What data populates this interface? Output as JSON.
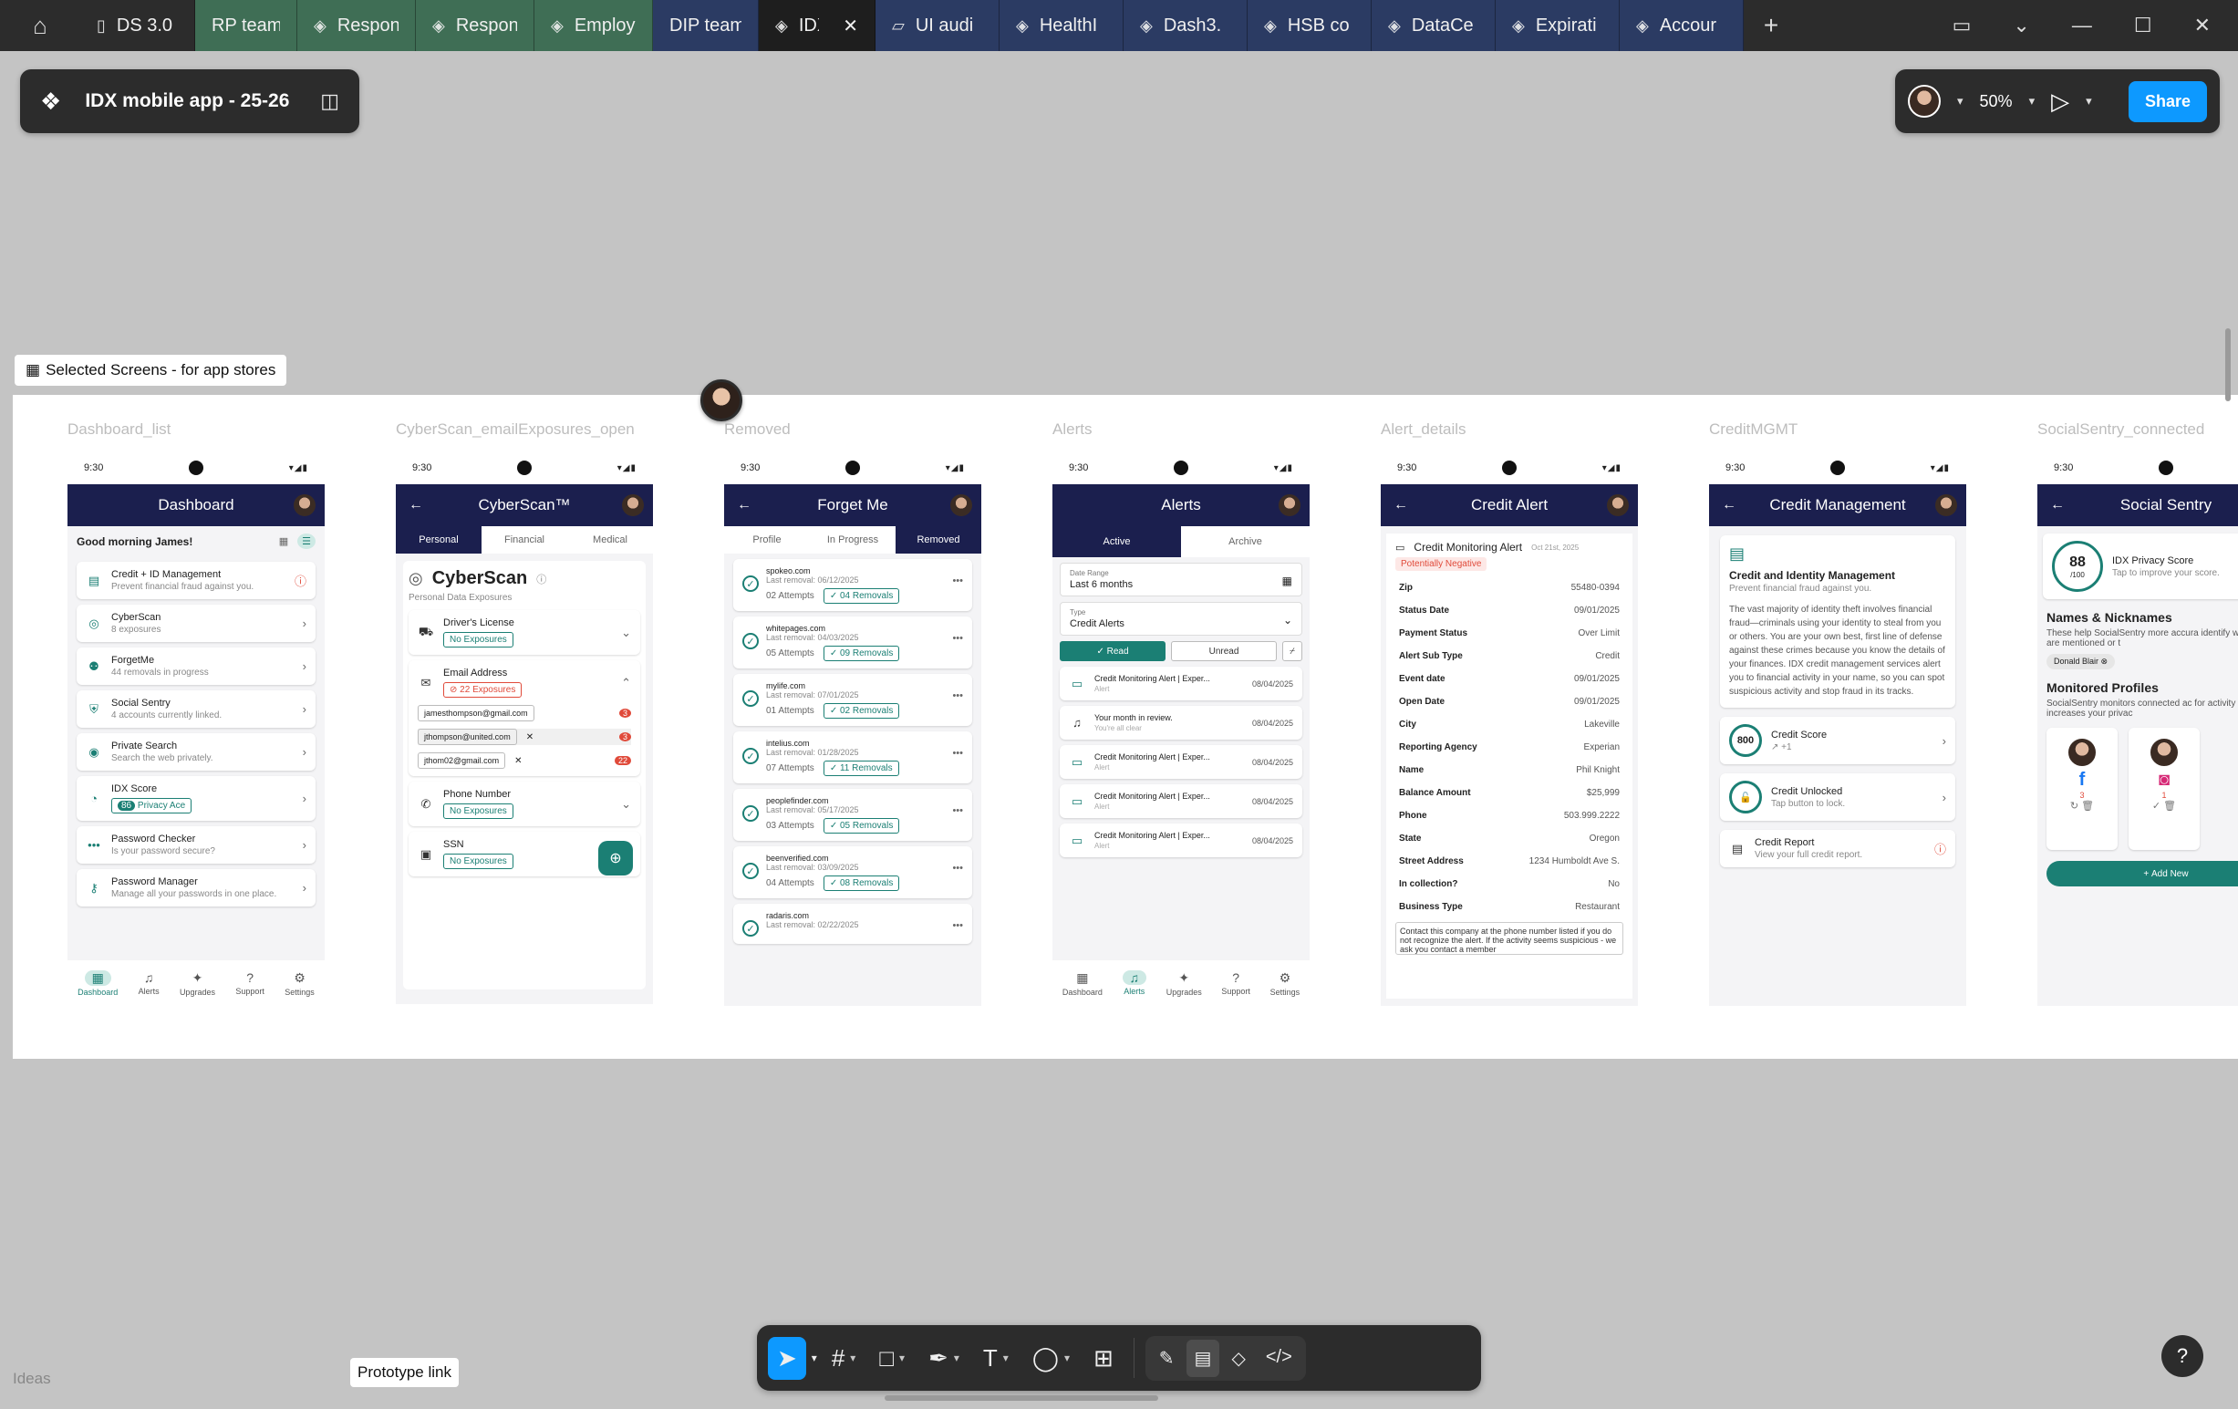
{
  "tabs": [
    {
      "label": "DS 3.0",
      "style": "dark",
      "icon": "book-icon"
    },
    {
      "label": "RP team",
      "style": "green",
      "icon": ""
    },
    {
      "label": "Respon",
      "style": "green",
      "icon": "figma-file-icon"
    },
    {
      "label": "Respon",
      "style": "green",
      "icon": "figma-file-icon"
    },
    {
      "label": "Employ",
      "style": "green",
      "icon": "figma-file-icon"
    },
    {
      "label": "DIP team",
      "style": "navy",
      "icon": ""
    },
    {
      "label": "IDX",
      "style": "active",
      "icon": "figma-file-icon"
    },
    {
      "label": "UI audi",
      "style": "navy",
      "icon": "figjam-icon"
    },
    {
      "label": "HealthI",
      "style": "navy",
      "icon": "figma-file-icon"
    },
    {
      "label": "Dash3.",
      "style": "navy",
      "icon": "figma-file-icon"
    },
    {
      "label": "HSB co",
      "style": "navy",
      "icon": "figma-file-icon"
    },
    {
      "label": "DataCe",
      "style": "navy",
      "icon": "figma-file-icon"
    },
    {
      "label": "Expirati",
      "style": "navy",
      "icon": "figma-file-icon"
    },
    {
      "label": "Accour",
      "style": "navy",
      "icon": "figma-file-icon"
    }
  ],
  "file": {
    "name": "IDX mobile app - 25-26"
  },
  "toolbar_right": {
    "zoom": "50%",
    "share": "Share"
  },
  "section": {
    "label": "Selected Screens - for app stores"
  },
  "frames": {
    "f1": "Dashboard_list",
    "f2": "CyberScan_emailExposures_open",
    "f3": "Removed",
    "f4": "Alerts",
    "f5": "Alert_details",
    "f6": "CreditMGMT",
    "f7": "SocialSentry_connected"
  },
  "phone_time": "9:30",
  "nav": {
    "dashboard": "Dashboard",
    "alerts": "Alerts",
    "upgrades": "Upgrades",
    "support": "Support",
    "settings": "Settings"
  },
  "dashboard": {
    "title": "Dashboard",
    "greeting": "Good morning James!",
    "items": [
      {
        "title": "Credit + ID Management",
        "sub": "Prevent financial fraud against you."
      },
      {
        "title": "CyberScan",
        "sub": "8 exposures"
      },
      {
        "title": "ForgetMe",
        "sub": "44 removals in progress"
      },
      {
        "title": "Social Sentry",
        "sub": "4 accounts currently linked."
      },
      {
        "title": "Private Search",
        "sub": "Search the web privately."
      },
      {
        "title": "IDX Score",
        "sub": "Privacy Ace",
        "pill": "86"
      },
      {
        "title": "Password Checker",
        "sub": "Is your password secure?"
      },
      {
        "title": "Password Manager",
        "sub": "Manage all your passwords in one place."
      }
    ]
  },
  "cyberscan": {
    "title": "CyberScan™",
    "tabs": [
      "Personal",
      "Financial",
      "Medical"
    ],
    "heading": "CyberScan",
    "sub": "Personal Data Exposures",
    "license": {
      "title": "Driver's License",
      "badge": "No Exposures"
    },
    "email": {
      "title": "Email Address",
      "badge": "22 Exposures",
      "entries": [
        {
          "email": "jamesthompson@gmail.com",
          "count": "3"
        },
        {
          "email": "jthompson@united.com",
          "count": "3"
        },
        {
          "email": "jthom02@gmail.com",
          "count": "22"
        }
      ]
    },
    "phone": {
      "title": "Phone Number",
      "badge": "No Exposures"
    },
    "ssn": {
      "title": "SSN",
      "badge": "No Exposures"
    }
  },
  "forgetme": {
    "title": "Forget Me",
    "tabs": [
      "Profile",
      "In Progress",
      "Removed"
    ],
    "items": [
      {
        "site": "spokeo.com",
        "date": "Last removal: 06/12/2025",
        "attempts": "02 Attempts",
        "removals": "04 Removals"
      },
      {
        "site": "whitepages.com",
        "date": "Last removal: 04/03/2025",
        "attempts": "05 Attempts",
        "removals": "09 Removals"
      },
      {
        "site": "mylife.com",
        "date": "Last removal: 07/01/2025",
        "attempts": "01 Attempts",
        "removals": "02 Removals"
      },
      {
        "site": "intelius.com",
        "date": "Last removal: 01/28/2025",
        "attempts": "07 Attempts",
        "removals": "11 Removals"
      },
      {
        "site": "peoplefinder.com",
        "date": "Last removal: 05/17/2025",
        "attempts": "03 Attempts",
        "removals": "05 Removals"
      },
      {
        "site": "beenverified.com",
        "date": "Last removal: 03/09/2025",
        "attempts": "04 Attempts",
        "removals": "08 Removals"
      },
      {
        "site": "radaris.com",
        "date": "Last removal: 02/22/2025",
        "attempts": "",
        "removals": ""
      }
    ]
  },
  "alerts": {
    "title": "Alerts",
    "tabs": [
      "Active",
      "Archive"
    ],
    "date_label": "Date Range",
    "date_value": "Last 6 months",
    "type_label": "Type",
    "type_value": "Credit Alerts",
    "read": "Read",
    "unread": "Unread",
    "items": [
      {
        "title": "Credit Monitoring Alert | Exper...",
        "sub": "Alert",
        "date": "08/04/2025"
      },
      {
        "title": "Your month in review.",
        "sub": "You're all clear",
        "date": "08/04/2025"
      },
      {
        "title": "Credit Monitoring Alert | Exper...",
        "sub": "Alert",
        "date": "08/04/2025"
      },
      {
        "title": "Credit Monitoring Alert | Exper...",
        "sub": "Alert",
        "date": "08/04/2025"
      },
      {
        "title": "Credit Monitoring Alert | Exper...",
        "sub": "Alert",
        "date": "08/04/2025"
      }
    ]
  },
  "creditalert": {
    "title": "Credit Alert",
    "heading": "Credit Monitoring Alert",
    "date": "Oct 21st, 2025",
    "tag": "Potentially Negative",
    "fields": [
      {
        "k": "Zip",
        "v": "55480-0394"
      },
      {
        "k": "Status Date",
        "v": "09/01/2025"
      },
      {
        "k": "Payment Status",
        "v": "Over Limit"
      },
      {
        "k": "Alert Sub Type",
        "v": "Credit"
      },
      {
        "k": "Event date",
        "v": "09/01/2025"
      },
      {
        "k": "Open Date",
        "v": "09/01/2025"
      },
      {
        "k": "City",
        "v": "Lakeville"
      },
      {
        "k": "Reporting Agency",
        "v": "Experian"
      },
      {
        "k": "Name",
        "v": "Phil Knight"
      },
      {
        "k": "Balance Amount",
        "v": "$25,999"
      },
      {
        "k": "Phone",
        "v": "503.999.2222"
      },
      {
        "k": "State",
        "v": "Oregon"
      },
      {
        "k": "Street Address",
        "v": "1234 Humboldt Ave S."
      },
      {
        "k": "In collection?",
        "v": "No"
      },
      {
        "k": "Business Type",
        "v": "Restaurant"
      }
    ],
    "note": "Contact this company at the phone number listed if you do not recognize the alert. If the activity seems suspicious - we ask you contact a member"
  },
  "credit": {
    "title": "Credit Management",
    "heading": "Credit and Identity Management",
    "sub": "Prevent financial fraud against you.",
    "body": "The vast majority of identity theft involves financial fraud—criminals using your identity to steal from you or others. You are your own best, first line of defense against these crimes because you know the details of your finances. IDX credit management services alert you to financial activity in your name, so you can spot suspicious activity and stop fraud in its tracks.",
    "score_value": "800",
    "score_title": "Credit Score",
    "score_delta": "+1",
    "unlock_title": "Credit Unlocked",
    "unlock_sub": "Tap button to lock.",
    "report_title": "Credit Report",
    "report_sub": "View your full credit report."
  },
  "social": {
    "title": "Social Sentry",
    "score": "88",
    "score_max": "/100",
    "score_title": "IDX Privacy Score",
    "score_sub": "Tap to improve your score.",
    "names_title": "Names & Nicknames",
    "names_body": "These help SocialSentry more accura identify when you are mentioned or t",
    "chip": "Donald Blair",
    "profiles_title": "Monitored Profiles",
    "profiles_body": "SocialSentry monitors connected ac for activity that increases your privac",
    "add": "Add New",
    "badge1": "3",
    "badge2": "1"
  },
  "bottom": {
    "ideas": "Ideas",
    "prototype": "Prototype link"
  }
}
